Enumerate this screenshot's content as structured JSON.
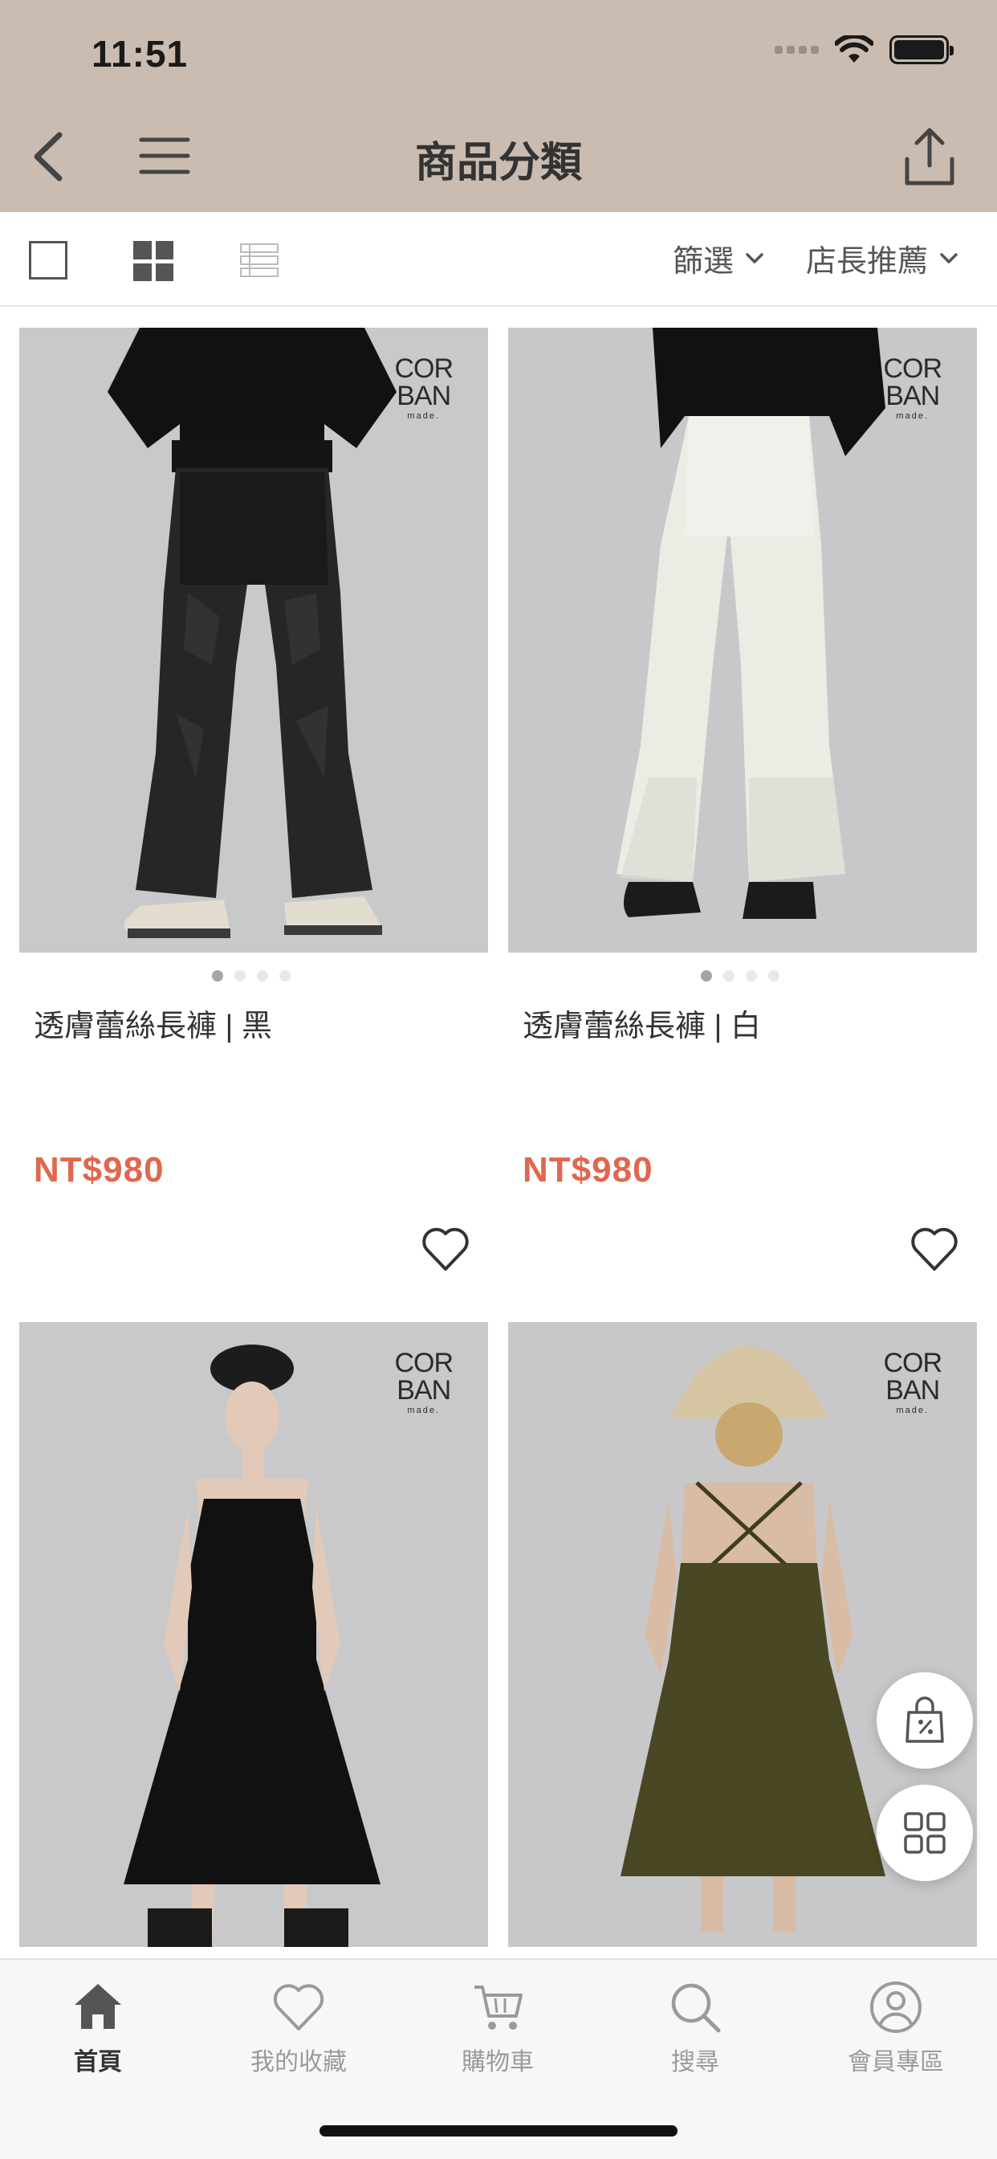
{
  "status_bar": {
    "time": "11:51"
  },
  "nav": {
    "title": "商品分類"
  },
  "toolbar": {
    "filter_label": "篩選",
    "sort_label": "店長推薦"
  },
  "brand": {
    "line1": "COR",
    "line2": "BAN",
    "line3": "made."
  },
  "products": [
    {
      "name": "透膚蕾絲長褲 | 黑",
      "price": "NT$980",
      "image_dots": 4,
      "active_dot": 1
    },
    {
      "name": "透膚蕾絲長褲 | 白",
      "price": "NT$980",
      "image_dots": 4,
      "active_dot": 1
    }
  ],
  "tabs": [
    {
      "label": "首頁",
      "icon": "home-icon",
      "active": true
    },
    {
      "label": "我的收藏",
      "icon": "heart-icon",
      "active": false
    },
    {
      "label": "購物車",
      "icon": "cart-icon",
      "active": false
    },
    {
      "label": "搜尋",
      "icon": "search-icon",
      "active": false
    },
    {
      "label": "會員專區",
      "icon": "user-icon",
      "active": false
    }
  ],
  "colors": {
    "header_bg": "#cbbcb1",
    "price": "#e0674d",
    "tab_active": "#333333",
    "tab_inactive": "#9a9a9a"
  }
}
